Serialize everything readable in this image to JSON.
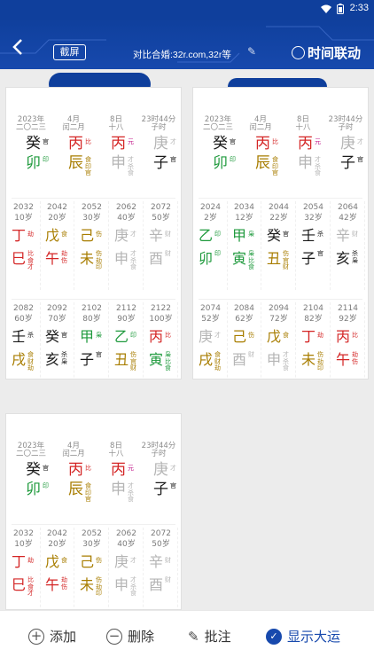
{
  "status": {
    "time": "2:33"
  },
  "appbar": {
    "capture": "截屏",
    "compare": "对比合婚:32r.com,32r等",
    "linkage": "时间联动"
  },
  "bottom": {
    "add": "添加",
    "delete": "删除",
    "annotate": "批注",
    "show": "显示大运"
  },
  "cards": [
    {
      "hdr": [
        [
          "2023年",
          "二〇二三"
        ],
        [
          "4月",
          "闰二月"
        ],
        [
          "8日",
          "十八"
        ],
        [
          "23时44分",
          "子时"
        ]
      ],
      "pillars": [
        {
          "g": "癸",
          "gc": "c-black",
          "gt": [
            "官"
          ],
          "gtc": "c-black",
          "z": "卯",
          "zc": "c-green",
          "zt": [
            "印"
          ],
          "ztc": "c-green"
        },
        {
          "g": "丙",
          "gc": "c-red",
          "gt": [
            "比"
          ],
          "gtc": "c-red",
          "z": "辰",
          "zc": "c-gold",
          "zt": [
            "食",
            "印",
            "官"
          ],
          "ztc": "c-gold"
        },
        {
          "g": "丙",
          "gc": "c-red",
          "gt": [
            "元"
          ],
          "gtc": "c-pink",
          "z": "申",
          "zc": "c-gray",
          "zt": [
            "才",
            "杀",
            "食"
          ],
          "ztc": "c-gray"
        },
        {
          "g": "庚",
          "gc": "c-gray",
          "gt": [
            "才"
          ],
          "gtc": "c-gray",
          "z": "子",
          "zc": "c-black",
          "zt": [
            "官"
          ],
          "ztc": "c-black"
        }
      ],
      "dy": [
        [
          {
            "y": "2032",
            "a": "10岁",
            "g": "丁",
            "gc": "c-red",
            "gt": "劫",
            "z": "巳",
            "zc": "c-red",
            "zt": "比\n食\n才"
          },
          {
            "y": "2042",
            "a": "20岁",
            "g": "戊",
            "gc": "c-gold",
            "gt": "食",
            "z": "午",
            "zc": "c-red",
            "zt": "劫\n伤"
          },
          {
            "y": "2052",
            "a": "30岁",
            "g": "己",
            "gc": "c-gold",
            "gt": "伤",
            "z": "未",
            "zc": "c-gold",
            "zt": "伤\n劫\n印"
          },
          {
            "y": "2062",
            "a": "40岁",
            "g": "庚",
            "gc": "c-gray",
            "gt": "才",
            "z": "申",
            "zc": "c-gray",
            "zt": "才\n杀\n食"
          },
          {
            "y": "2072",
            "a": "50岁",
            "g": "辛",
            "gc": "c-gray",
            "gt": "财",
            "z": "酉",
            "zc": "c-gray",
            "zt": "财"
          }
        ],
        [
          {
            "y": "2082",
            "a": "60岁",
            "g": "壬",
            "gc": "c-black",
            "gt": "杀",
            "z": "戌",
            "zc": "c-gold",
            "zt": "食\n财\n劫"
          },
          {
            "y": "2092",
            "a": "70岁",
            "g": "癸",
            "gc": "c-black",
            "gt": "官",
            "z": "亥",
            "zc": "c-black",
            "zt": "杀\n枭"
          },
          {
            "y": "2102",
            "a": "80岁",
            "g": "甲",
            "gc": "c-green",
            "gt": "枭",
            "z": "子",
            "zc": "c-black",
            "zt": "官"
          },
          {
            "y": "2112",
            "a": "90岁",
            "g": "乙",
            "gc": "c-green",
            "gt": "印",
            "z": "丑",
            "zc": "c-gold",
            "zt": "伤\n官\n财"
          },
          {
            "y": "2122",
            "a": "100岁",
            "g": "丙",
            "gc": "c-red",
            "gt": "比",
            "z": "寅",
            "zc": "c-green",
            "zt": "枭\n比\n食"
          }
        ]
      ]
    },
    {
      "hdr": [
        [
          "2023年",
          "二〇二三"
        ],
        [
          "4月",
          "闰二月"
        ],
        [
          "8日",
          "十八"
        ],
        [
          "23时44分",
          "子时"
        ]
      ],
      "pillars": [
        {
          "g": "癸",
          "gc": "c-black",
          "gt": [
            "官"
          ],
          "gtc": "c-black",
          "z": "卯",
          "zc": "c-green",
          "zt": [
            "印"
          ],
          "ztc": "c-green"
        },
        {
          "g": "丙",
          "gc": "c-red",
          "gt": [
            "比"
          ],
          "gtc": "c-red",
          "z": "辰",
          "zc": "c-gold",
          "zt": [
            "食",
            "印",
            "官"
          ],
          "ztc": "c-gold"
        },
        {
          "g": "丙",
          "gc": "c-red",
          "gt": [
            "元"
          ],
          "gtc": "c-pink",
          "z": "申",
          "zc": "c-gray",
          "zt": [
            "才",
            "杀",
            "食"
          ],
          "ztc": "c-gray"
        },
        {
          "g": "庚",
          "gc": "c-gray",
          "gt": [
            "才"
          ],
          "gtc": "c-gray",
          "z": "子",
          "zc": "c-black",
          "zt": [
            "官"
          ],
          "ztc": "c-black"
        }
      ],
      "dy": [
        [
          {
            "y": "2024",
            "a": "2岁",
            "g": "乙",
            "gc": "c-green",
            "gt": "印",
            "z": "卯",
            "zc": "c-green",
            "zt": "印"
          },
          {
            "y": "2034",
            "a": "12岁",
            "g": "甲",
            "gc": "c-green",
            "gt": "枭",
            "z": "寅",
            "zc": "c-green",
            "zt": "枭\n比\n食"
          },
          {
            "y": "2044",
            "a": "22岁",
            "g": "癸",
            "gc": "c-black",
            "gt": "官",
            "z": "丑",
            "zc": "c-gold",
            "zt": "伤\n官\n财"
          },
          {
            "y": "2054",
            "a": "32岁",
            "g": "壬",
            "gc": "c-black",
            "gt": "杀",
            "z": "子",
            "zc": "c-black",
            "zt": "官"
          },
          {
            "y": "2064",
            "a": "42岁",
            "g": "辛",
            "gc": "c-gray",
            "gt": "财",
            "z": "亥",
            "zc": "c-black",
            "zt": "杀\n枭"
          }
        ],
        [
          {
            "y": "2074",
            "a": "52岁",
            "g": "庚",
            "gc": "c-gray",
            "gt": "才",
            "z": "戌",
            "zc": "c-gold",
            "zt": "食\n财\n劫"
          },
          {
            "y": "2084",
            "a": "62岁",
            "g": "己",
            "gc": "c-gold",
            "gt": "伤",
            "z": "酉",
            "zc": "c-gray",
            "zt": "财"
          },
          {
            "y": "2094",
            "a": "72岁",
            "g": "戊",
            "gc": "c-gold",
            "gt": "食",
            "z": "申",
            "zc": "c-gray",
            "zt": "才\n杀\n食"
          },
          {
            "y": "2104",
            "a": "82岁",
            "g": "丁",
            "gc": "c-red",
            "gt": "劫",
            "z": "未",
            "zc": "c-gold",
            "zt": "伤\n劫\n印"
          },
          {
            "y": "2114",
            "a": "92岁",
            "g": "丙",
            "gc": "c-red",
            "gt": "比",
            "z": "午",
            "zc": "c-red",
            "zt": "劫\n伤"
          }
        ]
      ]
    },
    {
      "hdr": [
        [
          "2023年",
          "二〇二三"
        ],
        [
          "4月",
          "闰二月"
        ],
        [
          "8日",
          "十八"
        ],
        [
          "23时44分",
          "子时"
        ]
      ],
      "pillars": [
        {
          "g": "癸",
          "gc": "c-black",
          "gt": [
            "官"
          ],
          "gtc": "c-black",
          "z": "卯",
          "zc": "c-green",
          "zt": [
            "印"
          ],
          "ztc": "c-green"
        },
        {
          "g": "丙",
          "gc": "c-red",
          "gt": [
            "比"
          ],
          "gtc": "c-red",
          "z": "辰",
          "zc": "c-gold",
          "zt": [
            "食",
            "印",
            "官"
          ],
          "ztc": "c-gold"
        },
        {
          "g": "丙",
          "gc": "c-red",
          "gt": [
            "元"
          ],
          "gtc": "c-pink",
          "z": "申",
          "zc": "c-gray",
          "zt": [
            "才",
            "杀",
            "食"
          ],
          "ztc": "c-gray"
        },
        {
          "g": "庚",
          "gc": "c-gray",
          "gt": [
            "才"
          ],
          "gtc": "c-gray",
          "z": "子",
          "zc": "c-black",
          "zt": [
            "官"
          ],
          "ztc": "c-black"
        }
      ],
      "dy": [
        [
          {
            "y": "2032",
            "a": "10岁",
            "g": "丁",
            "gc": "c-red",
            "gt": "劫",
            "z": "巳",
            "zc": "c-red",
            "zt": "比\n食\n才"
          },
          {
            "y": "2042",
            "a": "20岁",
            "g": "戊",
            "gc": "c-gold",
            "gt": "食",
            "z": "午",
            "zc": "c-red",
            "zt": "劫\n伤"
          },
          {
            "y": "2052",
            "a": "30岁",
            "g": "己",
            "gc": "c-gold",
            "gt": "伤",
            "z": "未",
            "zc": "c-gold",
            "zt": "伤\n劫\n印"
          },
          {
            "y": "2062",
            "a": "40岁",
            "g": "庚",
            "gc": "c-gray",
            "gt": "才",
            "z": "申",
            "zc": "c-gray",
            "zt": "才\n杀\n食"
          },
          {
            "y": "2072",
            "a": "50岁",
            "g": "辛",
            "gc": "c-gray",
            "gt": "财",
            "z": "酉",
            "zc": "c-gray",
            "zt": "财"
          }
        ]
      ]
    }
  ]
}
